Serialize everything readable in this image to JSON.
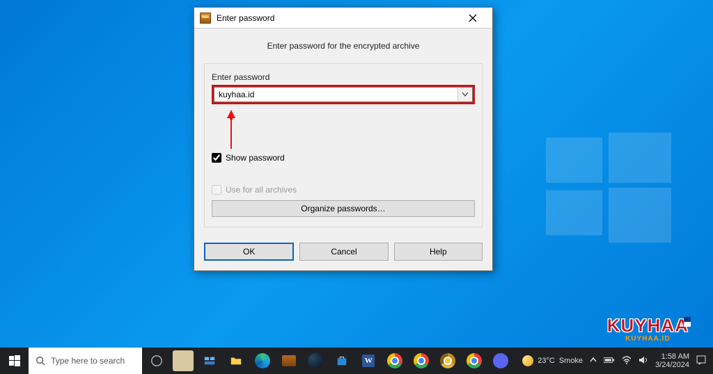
{
  "dialog": {
    "title": "Enter password",
    "headline": "Enter password for the encrypted archive",
    "field_label": "Enter password",
    "password_value": "kuyhaa.id",
    "show_password_label": "Show password",
    "show_password_checked": true,
    "use_all_label": "Use for all archives",
    "use_all_checked": false,
    "organize_label": "Organize passwords…",
    "ok_label": "OK",
    "cancel_label": "Cancel",
    "help_label": "Help"
  },
  "taskbar": {
    "search_placeholder": "Type here to search",
    "weather_temp": "23°C",
    "weather_desc": "Smoke",
    "time": "1:58 AM",
    "date": "3/24/2024"
  },
  "branding": {
    "main": "KUYHAA",
    "sub": "KUYHAA.ID"
  }
}
